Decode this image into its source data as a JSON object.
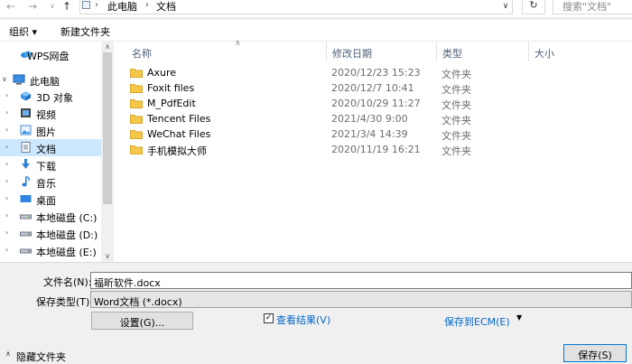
{
  "address": {
    "path": [
      "此电脑",
      "文档"
    ],
    "search_placeholder": "搜索\"文档\""
  },
  "toolbar": {
    "organize_label": "组织 ▾",
    "new_folder_label": "新建文件夹"
  },
  "nav": {
    "items": [
      {
        "label": "WPS网盘",
        "icon": "cloud-icon",
        "expanded": false
      },
      {
        "label": "此电脑",
        "icon": "computer-icon",
        "expanded": true
      },
      {
        "label": "3D 对象",
        "icon": "3d-objects-icon",
        "expanded": false
      },
      {
        "label": "视频",
        "icon": "video-icon",
        "expanded": false
      },
      {
        "label": "图片",
        "icon": "pictures-icon",
        "expanded": false
      },
      {
        "label": "文档",
        "icon": "documents-icon",
        "expanded": false,
        "selected": true
      },
      {
        "label": "下载",
        "icon": "download-icon",
        "expanded": false
      },
      {
        "label": "音乐",
        "icon": "music-icon",
        "expanded": false
      },
      {
        "label": "桌面",
        "icon": "desktop-icon",
        "expanded": false
      },
      {
        "label": "本地磁盘 (C:)",
        "icon": "drive-icon",
        "expanded": false
      },
      {
        "label": "本地磁盘 (D:)",
        "icon": "drive-icon",
        "expanded": false
      },
      {
        "label": "本地磁盘 (E:)",
        "icon": "drive-icon",
        "expanded": false
      }
    ]
  },
  "files": {
    "columns": [
      "名称",
      "修改日期",
      "类型",
      "大小"
    ],
    "rows": [
      {
        "name": "Axure",
        "date": "2020/12/23 15:23",
        "type": "文件夹"
      },
      {
        "name": "Foxit files",
        "date": "2020/12/7 10:41",
        "type": "文件夹"
      },
      {
        "name": "M_PdfEdit",
        "date": "2020/10/29 11:27",
        "type": "文件夹"
      },
      {
        "name": "Tencent Files",
        "date": "2021/4/30 9:00",
        "type": "文件夹"
      },
      {
        "name": "WeChat Files",
        "date": "2021/3/4 14:39",
        "type": "文件夹"
      },
      {
        "name": "手机模拟大师",
        "date": "2020/11/19 16:21",
        "type": "文件夹"
      }
    ]
  },
  "form": {
    "filename_label": "文件名(N):",
    "filename_value": "福昕软件.docx",
    "filetype_label": "保存类型(T):",
    "filetype_value": "Word文档 (*.docx)",
    "settings_label": "设置(G)...",
    "view_result_label": "查看结果(V)",
    "save_to_ecm_label": "保存到ECM(E)",
    "hide_folders_label": "隐藏文件夹",
    "save_label": "保存(S)"
  },
  "colors": {
    "selected_bg": "#cce8ff",
    "folder": "#f5c84a",
    "link": "#0066cc",
    "header_text": "#4c607a"
  }
}
